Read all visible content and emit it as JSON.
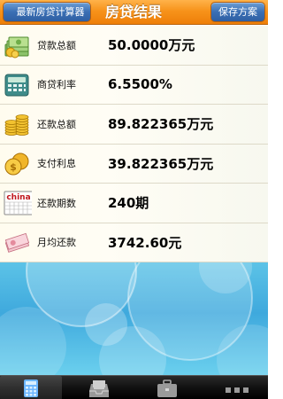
{
  "navbar": {
    "back_label": "最新房贷计算器",
    "title": "房贷结果",
    "save_label": "保存方案"
  },
  "results": [
    {
      "icon": "money-stack-icon",
      "label": "贷款总额",
      "value": "50.0000万元"
    },
    {
      "icon": "calculator-icon",
      "label": "商贷利率",
      "value": "6.5500%"
    },
    {
      "icon": "coin-stack-icon",
      "label": "还款总额",
      "value": "89.822365万元"
    },
    {
      "icon": "gold-coins-icon",
      "label": "支付利息",
      "value": "39.822365万元"
    },
    {
      "icon": "calendar-icon",
      "label": "还款期数",
      "value": "240期"
    },
    {
      "icon": "banknotes-icon",
      "label": "月均还款",
      "value": "3742.60元"
    }
  ],
  "calendar_icon_text": "china",
  "tabbar": {
    "tabs": [
      {
        "icon": "calculator-tab-icon",
        "active": true
      },
      {
        "icon": "inbox-tray-tab-icon",
        "active": false
      },
      {
        "icon": "briefcase-tab-icon",
        "active": false
      },
      {
        "icon": "more-dots-tab-icon",
        "active": false
      }
    ]
  },
  "colors": {
    "navbar": "#f7931b",
    "nav_button": "#3a6fb4",
    "background_art": "#3fa9dd",
    "tabbar": "#111111"
  }
}
